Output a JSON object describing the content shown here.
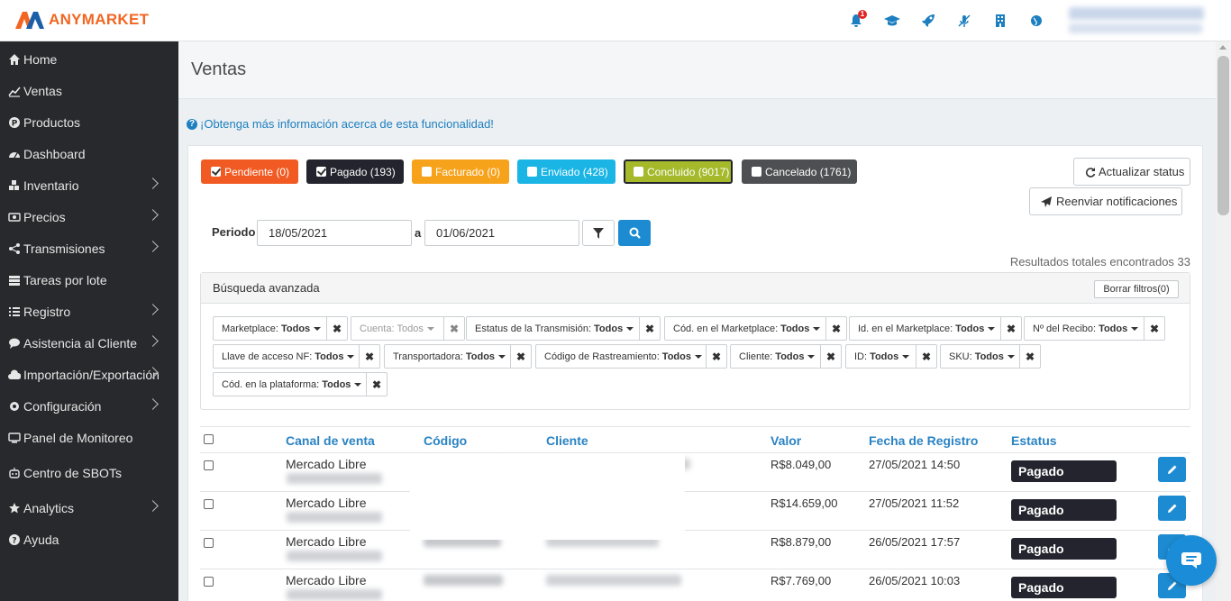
{
  "brand": {
    "name": "ANYMARKET",
    "color": "#f26522"
  },
  "header": {
    "icons": [
      "bell-icon",
      "graduation-cap-icon",
      "rocket-icon",
      "microphone-off-icon",
      "building-icon",
      "globe-icon"
    ],
    "notification_count": "1"
  },
  "sidebar": {
    "items": [
      {
        "label": "Home",
        "icon": "home-icon",
        "has_submenu": false
      },
      {
        "label": "Ventas",
        "icon": "line-chart-icon",
        "has_submenu": false
      },
      {
        "label": "Productos",
        "icon": "product-icon",
        "has_submenu": false
      },
      {
        "label": "Dashboard",
        "icon": "dashboard-icon",
        "has_submenu": false
      },
      {
        "label": "Inventario",
        "icon": "cubes-icon",
        "has_submenu": true
      },
      {
        "label": "Precios",
        "icon": "money-icon",
        "has_submenu": true
      },
      {
        "label": "Transmisiones",
        "icon": "share-icon",
        "has_submenu": true
      },
      {
        "label": "Tareas por lote",
        "icon": "tasks-icon",
        "has_submenu": false
      },
      {
        "label": "Registro",
        "icon": "list-icon",
        "has_submenu": true
      },
      {
        "label": "Asistencia al Cliente",
        "icon": "comments-icon",
        "has_submenu": true
      },
      {
        "label": "Importación/Exportación",
        "icon": "cloud-icon",
        "has_submenu": true
      },
      {
        "label": "Configuración",
        "icon": "gear-icon",
        "has_submenu": true
      },
      {
        "label": "Panel de Monitoreo",
        "icon": "desktop-icon",
        "has_submenu": false
      },
      {
        "label": "Centro de SBOTs",
        "icon": "robot-icon",
        "has_submenu": false
      },
      {
        "label": "Analytics",
        "icon": "star-icon",
        "has_submenu": true
      },
      {
        "label": "Ayuda",
        "icon": "question-icon",
        "has_submenu": false
      }
    ]
  },
  "page": {
    "title": "Ventas",
    "info_link": "¡Obtenga más información acerca de esta funcionalidad!"
  },
  "status_filters": [
    {
      "label": "Pendiente (0)",
      "checked": true,
      "color": "#f15a22"
    },
    {
      "label": "Pagado (193)",
      "checked": true,
      "color": "#23242d"
    },
    {
      "label": "Facturado (0)",
      "checked": false,
      "color": "#f7a21b"
    },
    {
      "label": "Enviado (428)",
      "checked": false,
      "color": "#1ab5e5"
    },
    {
      "label": "Concluido (9017)",
      "checked": false,
      "color": "#a5b92a"
    },
    {
      "label": "Cancelado (1761)",
      "checked": false,
      "color": "#4d4f52"
    }
  ],
  "actions": {
    "refresh": "Actualizar status",
    "resend": "Reenviar notificaciones"
  },
  "period": {
    "label": "Periodo",
    "from": "18/05/2021",
    "separator": "a",
    "to": "01/06/2021"
  },
  "results": "Resultados totales encontrados 33",
  "advanced_search": {
    "title": "Búsqueda avanzada",
    "clear": "Borrar filtros(0)",
    "filters": [
      {
        "name": "Marketplace:",
        "value": "Todos",
        "muted": false
      },
      {
        "name": "Cuenta:",
        "value": "Todos",
        "muted": true
      },
      {
        "name": "Estatus de la Transmisión:",
        "value": "Todos",
        "muted": false
      },
      {
        "name": "Cód. en el Marketplace:",
        "value": "Todos",
        "muted": false
      },
      {
        "name": "Id. en el Marketplace:",
        "value": "Todos",
        "muted": false
      },
      {
        "name": "Nº del Recibo:",
        "value": "Todos",
        "muted": false
      },
      {
        "name": "Llave de acceso NF:",
        "value": "Todos",
        "muted": false
      },
      {
        "name": "Transportadora:",
        "value": "Todos",
        "muted": false
      },
      {
        "name": "Código de Rastreamiento:",
        "value": "Todos",
        "muted": false
      },
      {
        "name": "Cliente:",
        "value": "Todos",
        "muted": false
      },
      {
        "name": "ID:",
        "value": "Todos",
        "muted": false
      },
      {
        "name": "SKU:",
        "value": "Todos",
        "muted": false
      },
      {
        "name": "Cód. en la plataforma:",
        "value": "Todos",
        "muted": false
      }
    ]
  },
  "table": {
    "headers": [
      "Canal de venta",
      "Código",
      "Cliente",
      "Valor",
      "Fecha de Registro",
      "Estatus"
    ],
    "rows": [
      {
        "channel": "Mercado Libre",
        "value": "R$8.049,00",
        "date": "27/05/2021 14:50",
        "status": "Pagado"
      },
      {
        "channel": "Mercado Libre",
        "value": "R$14.659,00",
        "date": "27/05/2021 11:52",
        "status": "Pagado"
      },
      {
        "channel": "Mercado Libre",
        "value": "R$8.879,00",
        "date": "26/05/2021 17:57",
        "status": "Pagado"
      },
      {
        "channel": "Mercado Libre",
        "value": "R$7.769,00",
        "date": "26/05/2021 10:03",
        "status": "Pagado"
      }
    ]
  }
}
